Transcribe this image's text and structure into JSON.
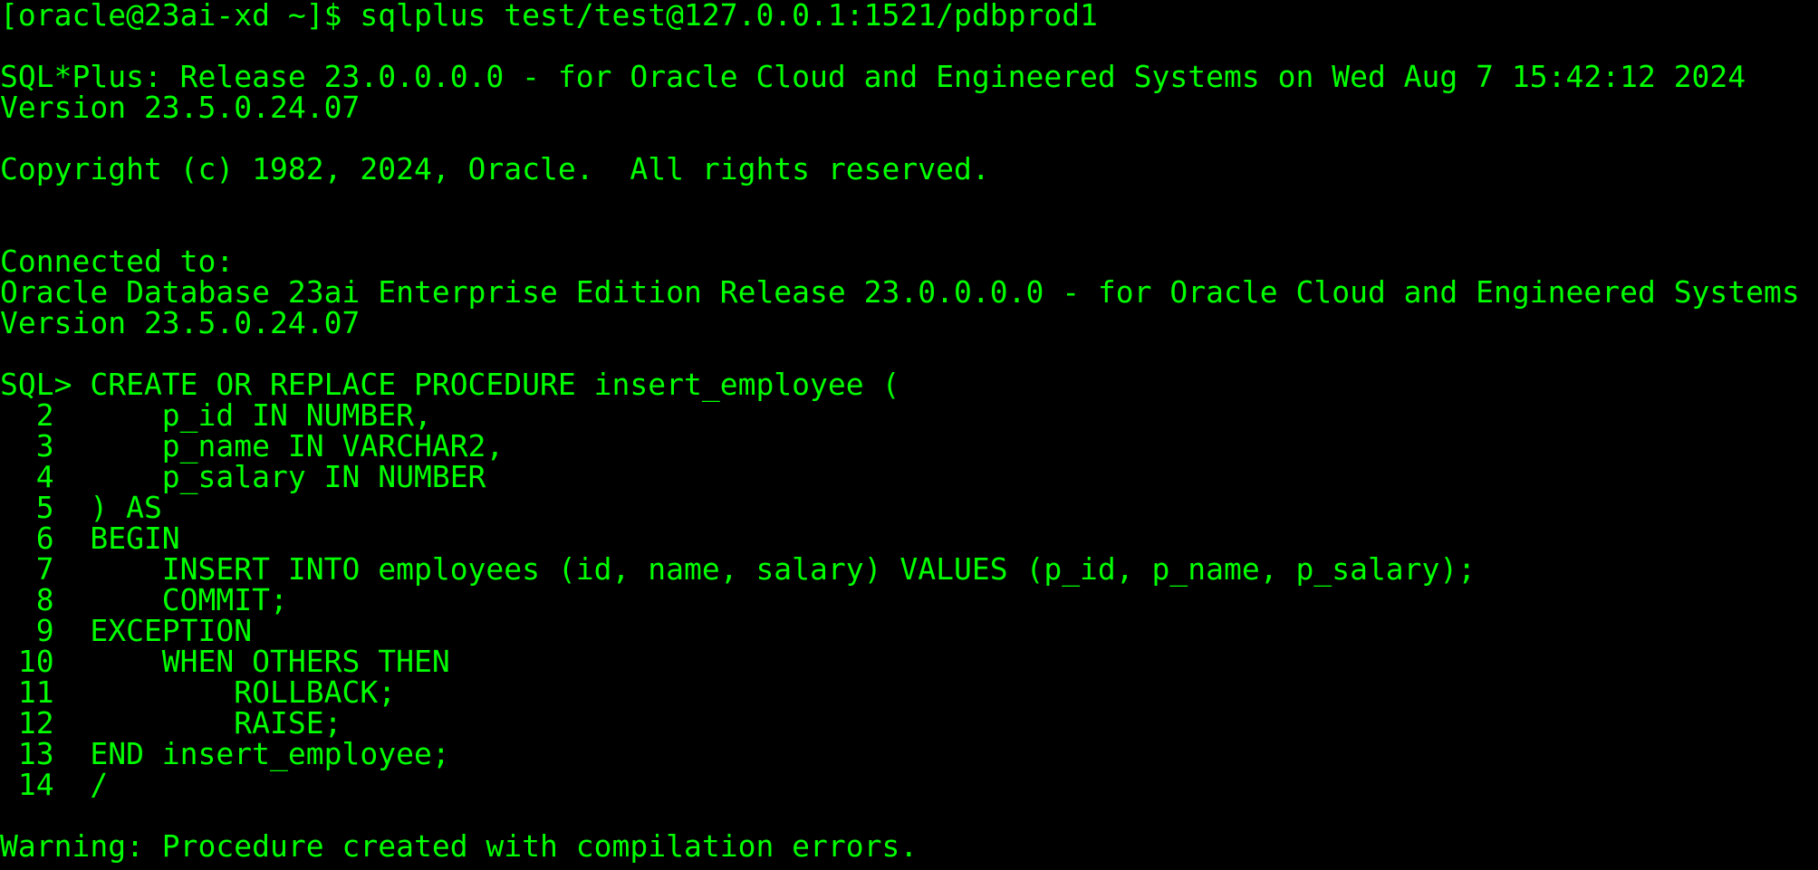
{
  "terminal": {
    "colors": {
      "background": "#000000",
      "foreground": "#00ff00"
    },
    "lines": [
      "[oracle@23ai-xd ~]$ sqlplus test/test@127.0.0.1:1521/pdbprod1",
      "",
      "SQL*Plus: Release 23.0.0.0.0 - for Oracle Cloud and Engineered Systems on Wed Aug 7 15:42:12 2024",
      "Version 23.5.0.24.07",
      "",
      "Copyright (c) 1982, 2024, Oracle.  All rights reserved.",
      "",
      "",
      "Connected to:",
      "Oracle Database 23ai Enterprise Edition Release 23.0.0.0.0 - for Oracle Cloud and Engineered Systems",
      "Version 23.5.0.24.07",
      "",
      "SQL> CREATE OR REPLACE PROCEDURE insert_employee (",
      "  2      p_id IN NUMBER,",
      "  3      p_name IN VARCHAR2,",
      "  4      p_salary IN NUMBER",
      "  5  ) AS",
      "  6  BEGIN",
      "  7      INSERT INTO employees (id, name, salary) VALUES (p_id, p_name, p_salary);",
      "  8      COMMIT;",
      "  9  EXCEPTION",
      " 10      WHEN OTHERS THEN",
      " 11          ROLLBACK;",
      " 12          RAISE;",
      " 13  END insert_employee;",
      " 14  /",
      "",
      "Warning: Procedure created with compilation errors."
    ]
  }
}
